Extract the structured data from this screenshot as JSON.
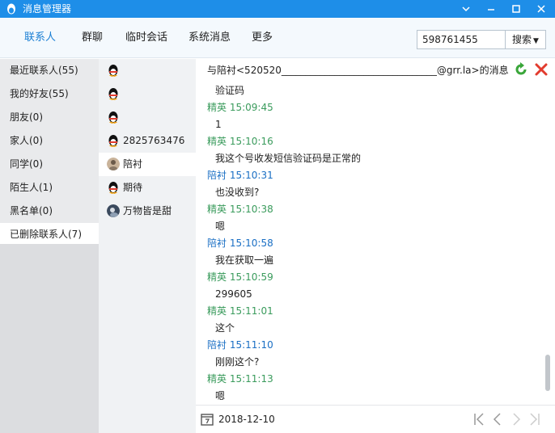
{
  "window": {
    "title": "消息管理器"
  },
  "tabs": [
    {
      "label": "联系人",
      "active": true
    },
    {
      "label": "群聊",
      "active": false
    },
    {
      "label": "临时会话",
      "active": false
    },
    {
      "label": "系统消息",
      "active": false
    },
    {
      "label": "更多",
      "active": false
    }
  ],
  "search": {
    "value": "598761455",
    "button_label": "搜索"
  },
  "groups": [
    {
      "label": "最近联系人(55)"
    },
    {
      "label": "我的好友(55)"
    },
    {
      "label": "朋友(0)"
    },
    {
      "label": "家人(0)"
    },
    {
      "label": "同学(0)"
    },
    {
      "label": "陌生人(1)"
    },
    {
      "label": "黑名单(0)"
    },
    {
      "label": "已删除联系人(7)",
      "selected": true
    }
  ],
  "contacts": [
    {
      "name": "",
      "avatar": "penguin-icon"
    },
    {
      "name": "",
      "avatar": "penguin-icon"
    },
    {
      "name": "",
      "avatar": "penguin-icon"
    },
    {
      "name": "2825763476",
      "avatar": "penguin-icon"
    },
    {
      "name": "陪衬",
      "avatar": "photo-avatar",
      "selected": true
    },
    {
      "name": "期待",
      "avatar": "penguin-icon"
    },
    {
      "name": "万物皆是甜",
      "avatar": "photo-avatar"
    }
  ],
  "chat": {
    "title": "与陪衬<520520________________________________@grr.la>的消息",
    "messages": [
      {
        "kind": "body",
        "text": "验证码"
      },
      {
        "kind": "sender-jy",
        "text": "精英 15:09:45"
      },
      {
        "kind": "body",
        "text": "1"
      },
      {
        "kind": "sender-jy",
        "text": "精英 15:10:16"
      },
      {
        "kind": "body",
        "text": "我这个号收发短信验证码是正常的"
      },
      {
        "kind": "sender-pc",
        "text": "陪衬 15:10:31"
      },
      {
        "kind": "body",
        "text": "也没收到?"
      },
      {
        "kind": "sender-jy",
        "text": "精英 15:10:38"
      },
      {
        "kind": "body",
        "text": "嗯"
      },
      {
        "kind": "sender-pc",
        "text": "陪衬 15:10:58"
      },
      {
        "kind": "body",
        "text": "我在获取一遍"
      },
      {
        "kind": "sender-jy",
        "text": "精英 15:10:59"
      },
      {
        "kind": "body",
        "text": "299605"
      },
      {
        "kind": "sender-jy",
        "text": "精英 15:11:01"
      },
      {
        "kind": "body",
        "text": "这个"
      },
      {
        "kind": "sender-pc",
        "text": "陪衬 15:11:10"
      },
      {
        "kind": "body",
        "text": "刚刚这个?"
      },
      {
        "kind": "sender-jy",
        "text": "精英 15:11:13"
      },
      {
        "kind": "body",
        "text": "嗯"
      }
    ],
    "date": "2018-12-10"
  },
  "colors": {
    "titlebar": "#1e8ee8",
    "active_tab": "#1a7fd4",
    "sender_self": "#3a9b5c",
    "sender_other": "#1a6fc4"
  }
}
